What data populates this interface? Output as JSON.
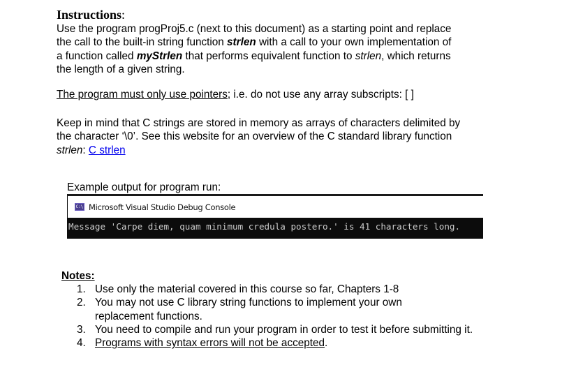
{
  "instructions": {
    "heading": "Instructions",
    "heading_colon": ":",
    "paragraph1": {
      "line1": "Use the program progProj5.c (next to this document) as a starting point and replace",
      "line2_before": "the call to the built-in string function ",
      "line2_emph": "strlen",
      "line2_after": " with a call to your own implementation of",
      "line3_before": "a function called ",
      "line3_emph": "myStrlen",
      "line3_middle": " that performs equivalent function to ",
      "line3_italic": "strlen",
      "line3_after": ", which returns",
      "line4": "the length of a given string."
    },
    "paragraph2": {
      "underlined": "The program must only use pointers",
      "rest": "; i.e. do not use any array subscripts: [ ]"
    },
    "paragraph3": {
      "line1": "Keep in mind that C strings are stored in memory as arrays of characters delimited by",
      "line2": "the character ‘\\0’. See this website for an overview of the C standard library function",
      "line3_italic": "strlen",
      "line3_colon": ": ",
      "link_text": "C strlen"
    }
  },
  "example": {
    "label": "Example output for program run:",
    "console": {
      "icon": "console-app-icon",
      "icon_text": "C:\\",
      "title": "Microsoft Visual Studio Debug Console",
      "output": "Message 'Carpe diem, quam minimum credula postero.' is 41 characters long."
    }
  },
  "notes": {
    "heading": "Notes:",
    "items": [
      {
        "num": "1.",
        "lines": [
          "Use only the material covered in this course so far, Chapters 1-8"
        ]
      },
      {
        "num": "2.",
        "lines": [
          "You may not use C library string functions to implement your own",
          "replacement functions."
        ]
      },
      {
        "num": "3.",
        "lines": [
          "You need to compile and run your program in order to test it before submitting it."
        ]
      },
      {
        "num": "4.",
        "underlined": "Programs with syntax errors will not be accepted",
        "after": "."
      }
    ]
  },
  "colors": {
    "link": "#0000ee",
    "console_bg": "#0c0c0c",
    "console_text": "#cccccc",
    "console_icon": "#4a3f8f"
  }
}
